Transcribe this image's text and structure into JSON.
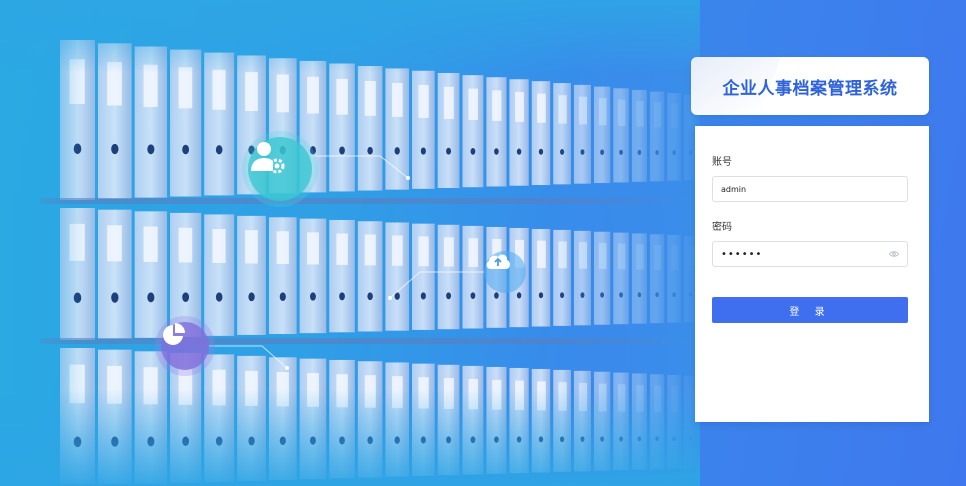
{
  "app": {
    "title": "企业人事档案管理系统"
  },
  "login": {
    "account_label": "账号",
    "account_value": "admin",
    "password_label": "密码",
    "password_value": "••••••",
    "submit_label": "登 录"
  },
  "icons": {
    "feature_1": "user-gear-icon",
    "feature_2": "cloud-upload-icon",
    "feature_3": "pie-chart-icon",
    "password_toggle": "eye-icon"
  },
  "colors": {
    "brand": "#2f63d9",
    "button": "#3f6fee",
    "bg_start": "#2aa9e3",
    "bg_end": "#3f78ee"
  }
}
